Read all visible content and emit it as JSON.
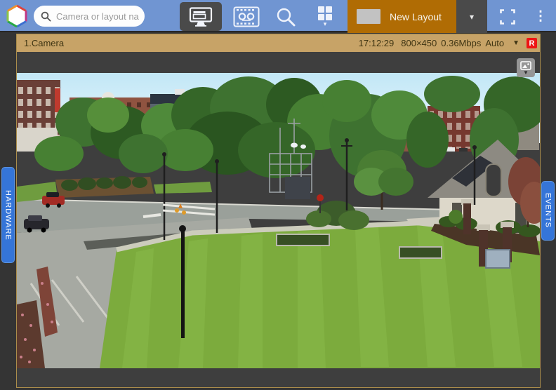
{
  "toolbar": {
    "search_placeholder": "Camera or layout na",
    "new_layout_label": "New Layout",
    "icons": {
      "caret_down": "▾",
      "ellipsis": "⋮",
      "small_caret": "▼"
    }
  },
  "camera_cell": {
    "title": "1.Camera",
    "status": {
      "time": "17:12:29",
      "resolution": "800×450",
      "bitrate": "0.36Mbps",
      "quality": "Auto"
    },
    "caret": "▼",
    "record_badge": "R"
  },
  "side_tabs": {
    "left_label": "HARDWARE",
    "right_label": "EVENTS"
  },
  "colors": {
    "toolbar_bg": "#7095d2",
    "selected_button_bg": "#4a4a4a",
    "new_layout_tab_bg": "#b06c04",
    "cell_titlebar_bg": "#c7a367",
    "record_badge_bg": "#ee1414",
    "side_tab_bg": "#3575d8",
    "window_bg": "#343434"
  }
}
